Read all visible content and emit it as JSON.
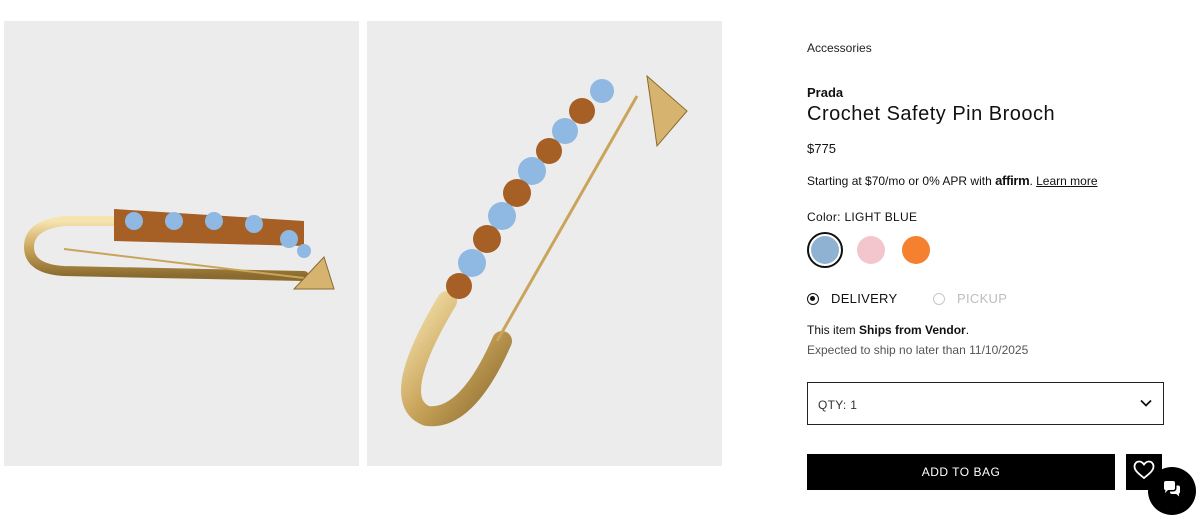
{
  "gallery": {
    "images": [
      {
        "alt": "Crochet Safety Pin Brooch side view"
      },
      {
        "alt": "Crochet Safety Pin Brooch angled view"
      }
    ]
  },
  "product": {
    "breadcrumb": "Accessories",
    "brand": "Prada",
    "title": "Crochet Safety Pin Brooch",
    "price": "$775",
    "financing": {
      "prefix": "Starting at $70/mo or 0% APR with",
      "logo": "affirm",
      "learn_more": "Learn more"
    },
    "color": {
      "label": "Color:",
      "selected": "LIGHT BLUE",
      "swatches": [
        {
          "name": "light blue",
          "hex": "#8fb2d3",
          "selected": true
        },
        {
          "name": "pink",
          "hex": "#f2c6cc",
          "selected": false
        },
        {
          "name": "orange",
          "hex": "#f5802f",
          "selected": false
        }
      ]
    },
    "fulfillment": {
      "delivery": "DELIVERY",
      "pickup": "PICKUP",
      "selected": "DELIVERY"
    },
    "shipping": {
      "prefix": "This item",
      "emphasis": "Ships from Vendor",
      "suffix": ".",
      "expected": "Expected to ship no later than 11/10/2025"
    },
    "quantity": {
      "label": "QTY:",
      "value": "1"
    },
    "add_to_bag": "ADD TO BAG"
  },
  "icons": {
    "wishlist": "heart-icon",
    "chat": "chat-bubbles-icon",
    "dropdown": "chevron-down-icon"
  },
  "colors": {
    "accent": "#000000",
    "swatch_light_blue": "#8fb2d3",
    "swatch_pink": "#f2c6cc",
    "swatch_orange": "#f5802f"
  }
}
